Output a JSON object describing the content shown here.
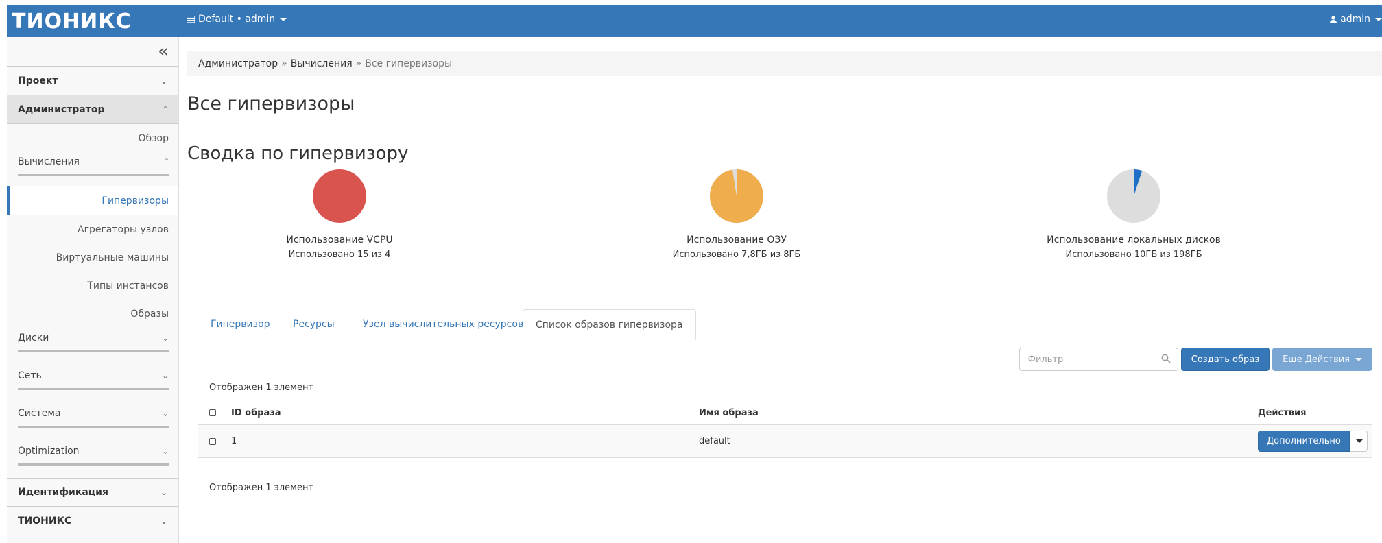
{
  "header": {
    "logo": "ТИОНИКС",
    "project_selector": "Default • admin",
    "user_menu": "admin"
  },
  "sidebar": {
    "sections": [
      {
        "label": "Проект"
      },
      {
        "label": "Администратор"
      }
    ],
    "admin_items": {
      "overview": "Обзор",
      "compute_group": "Вычисления",
      "compute_items": [
        "Гипервизоры",
        "Агрегаторы узлов",
        "Виртуальные машины",
        "Типы инстансов",
        "Образы"
      ],
      "groups": [
        "Диски",
        "Сеть",
        "Система",
        "Optimization"
      ]
    },
    "bottom_sections": [
      "Идентификация",
      "ТИОНИКС"
    ]
  },
  "breadcrumb": {
    "items": [
      "Администратор",
      "Вычисления",
      "Все гипервизоры"
    ]
  },
  "page_title": "Все гипервизоры",
  "summary": {
    "title": "Сводка по гипервизору",
    "charts": [
      {
        "label": "Использование VCPU",
        "sub": "Использовано 15 из 4",
        "used": 15,
        "total": 4,
        "color": "#d9534f"
      },
      {
        "label": "Использование ОЗУ",
        "sub": "Использовано 7,8ГБ из 8ГБ",
        "used": 7.8,
        "total": 8,
        "color": "#f0ad4e"
      },
      {
        "label": "Использование локальных дисков",
        "sub": "Использовано 10ГБ из 198ГБ",
        "used": 10,
        "total": 198,
        "color": "#1f6fc6"
      }
    ]
  },
  "tabs": [
    "Гипервизор",
    "Ресурсы",
    "Узел вычислительных ресурсов",
    "Список образов гипервизора"
  ],
  "toolbar": {
    "filter_placeholder": "Фильтр",
    "create_label": "Создать образ",
    "more_actions_label": "Еще Действия"
  },
  "table": {
    "count_text": "Отображен 1 элемент",
    "headers": {
      "id": "ID образа",
      "name": "Имя образа",
      "actions": "Действия"
    },
    "rows": [
      {
        "id": "1",
        "name": "default",
        "action": "Дополнительно"
      }
    ]
  },
  "colors": {
    "brand": "#3677b7",
    "pie_empty": "#dddddd"
  }
}
